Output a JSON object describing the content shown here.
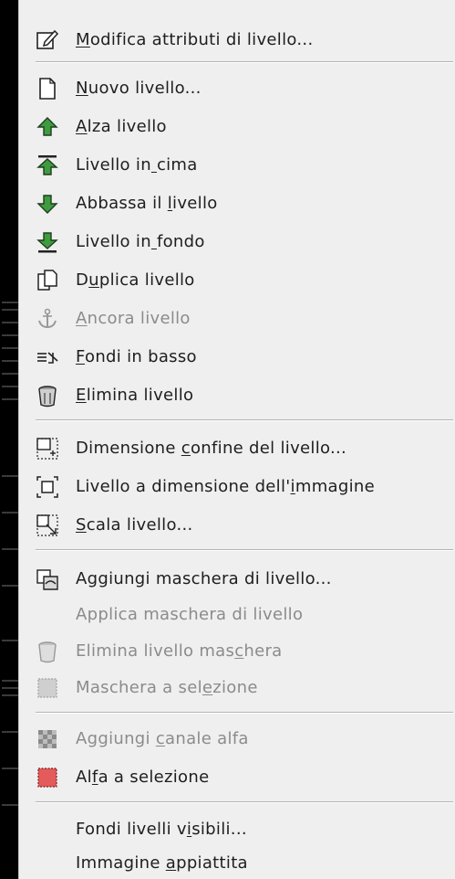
{
  "menu": {
    "items": [
      {
        "id": "modifica",
        "label": "Modifica attributi di livello...",
        "mnemonic_index": 0,
        "icon": "edit-layer-attributes-icon",
        "enabled": true
      },
      {
        "id": "nuovo",
        "label": "Nuovo livello...",
        "mnemonic_index": 0,
        "icon": "new-layer-icon",
        "enabled": true
      },
      {
        "id": "alza",
        "label": "Alza livello",
        "mnemonic_index": 0,
        "icon": "raise-layer-icon",
        "enabled": true
      },
      {
        "id": "cima",
        "label": "Livello in cima",
        "mnemonic_index": 10,
        "icon": "layer-to-top-icon",
        "enabled": true
      },
      {
        "id": "abbassa",
        "label": "Abbassa il livello",
        "mnemonic_index": 11,
        "icon": "lower-layer-icon",
        "enabled": true
      },
      {
        "id": "fondo",
        "label": "Livello in fondo",
        "mnemonic_index": 10,
        "icon": "layer-to-bottom-icon",
        "enabled": true
      },
      {
        "id": "duplica",
        "label": "Duplica livello",
        "mnemonic_index": 1,
        "icon": "duplicate-layer-icon",
        "enabled": true
      },
      {
        "id": "ancora",
        "label": "Ancora livello",
        "mnemonic_index": 0,
        "icon": "anchor-icon",
        "enabled": false
      },
      {
        "id": "fondi",
        "label": "Fondi in basso",
        "mnemonic_index": 0,
        "icon": "merge-down-icon",
        "enabled": true
      },
      {
        "id": "elimina",
        "label": "Elimina livello",
        "mnemonic_index": 0,
        "icon": "trash-icon",
        "enabled": true
      },
      {
        "id": "dimconf",
        "label": "Dimensione confine del livello...",
        "mnemonic_index": 11,
        "icon": "layer-boundary-size-icon",
        "enabled": true
      },
      {
        "id": "dimimg",
        "label": "Livello a dimensione dell'immagine",
        "mnemonic_index": 26,
        "icon": "layer-to-image-size-icon",
        "enabled": true
      },
      {
        "id": "scala",
        "label": "Scala livello...",
        "mnemonic_index": 0,
        "icon": "scale-layer-icon",
        "enabled": true
      },
      {
        "id": "aggmask",
        "label": "Aggiungi maschera di livello...",
        "mnemonic_index": -1,
        "icon": "add-mask-icon",
        "enabled": true
      },
      {
        "id": "appmask",
        "label": "Applica maschera di livello",
        "mnemonic_index": -1,
        "icon": "",
        "enabled": false
      },
      {
        "id": "elimmask",
        "label": "Elimina livello maschera",
        "mnemonic_index": 19,
        "icon": "trash-icon",
        "enabled": false
      },
      {
        "id": "masksel",
        "label": "Maschera a selezione",
        "mnemonic_index": 14,
        "icon": "mask-to-selection-icon",
        "enabled": false
      },
      {
        "id": "alfa",
        "label": "Aggiungi canale alfa",
        "mnemonic_index": 9,
        "icon": "alpha-channel-icon",
        "enabled": false
      },
      {
        "id": "alfasel",
        "label": "Alfa a selezione",
        "mnemonic_index": 2,
        "icon": "alpha-to-selection-icon",
        "enabled": true
      },
      {
        "id": "fondivis",
        "label": "Fondi livelli visibili...",
        "mnemonic_index": 15,
        "icon": "",
        "enabled": true
      },
      {
        "id": "appiatt",
        "label": "Immagine appiattita",
        "mnemonic_index": 9,
        "icon": "",
        "enabled": true
      }
    ]
  },
  "colors": {
    "menu_bg": "#efefef",
    "text": "#1e1e1e",
    "disabled_text": "#8b8b8b",
    "arrow_green": "#2e7d2e",
    "alpha_red": "#e35b5b"
  }
}
